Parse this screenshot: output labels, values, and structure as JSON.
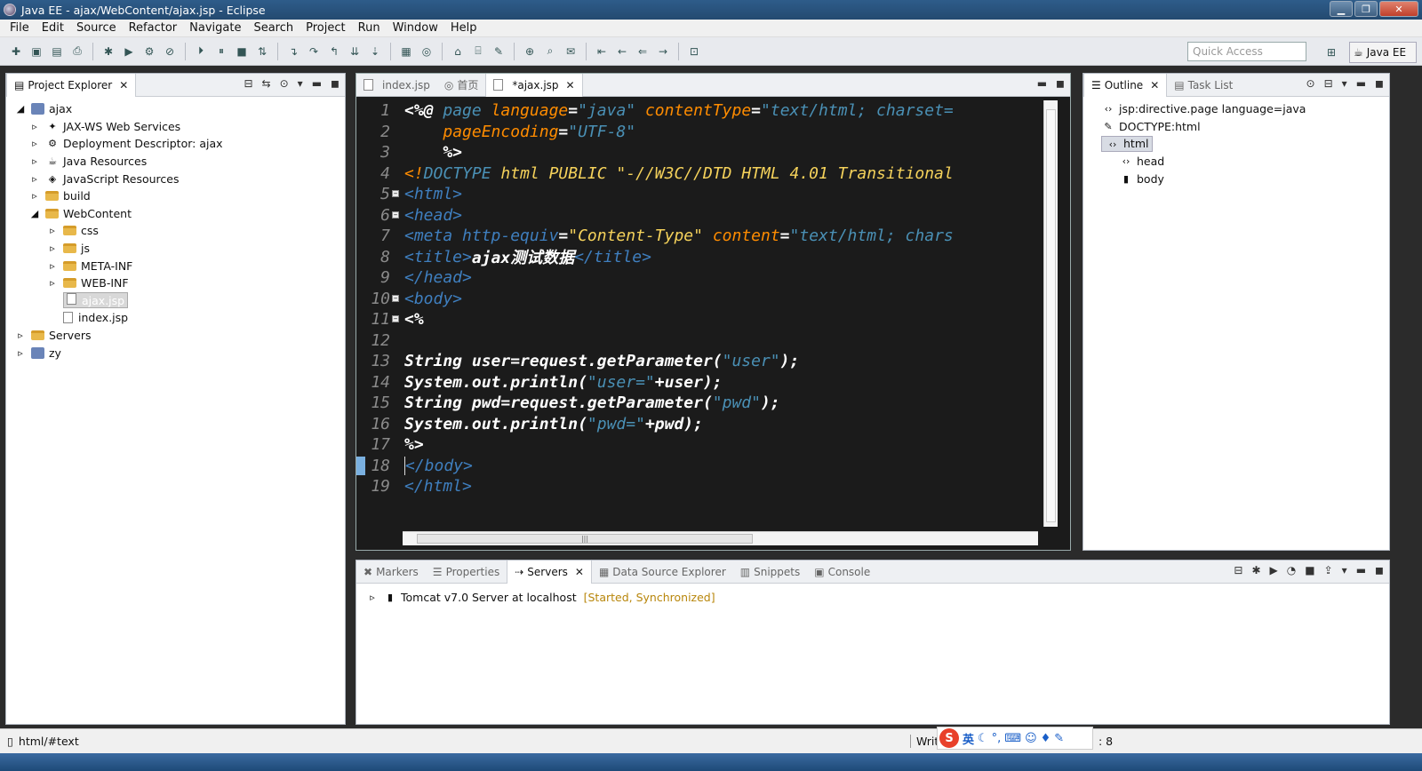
{
  "window": {
    "title": "Java EE - ajax/WebContent/ajax.jsp - Eclipse"
  },
  "menu": [
    "File",
    "Edit",
    "Source",
    "Refactor",
    "Navigate",
    "Search",
    "Project",
    "Run",
    "Window",
    "Help"
  ],
  "toolbar": {
    "quick_access_placeholder": "Quick Access",
    "perspective": "Java EE"
  },
  "project_explorer": {
    "tab_label": "Project Explorer",
    "items": [
      {
        "label": "ajax",
        "level": 0,
        "kind": "project"
      },
      {
        "label": "JAX-WS Web Services",
        "level": 1,
        "kind": "service"
      },
      {
        "label": "Deployment Descriptor: ajax",
        "level": 1,
        "kind": "descriptor"
      },
      {
        "label": "Java Resources",
        "level": 1,
        "kind": "resources"
      },
      {
        "label": "JavaScript Resources",
        "level": 1,
        "kind": "resources"
      },
      {
        "label": "build",
        "level": 1,
        "kind": "folder"
      },
      {
        "label": "WebContent",
        "level": 1,
        "kind": "folder"
      },
      {
        "label": "css",
        "level": 2,
        "kind": "folder"
      },
      {
        "label": "js",
        "level": 2,
        "kind": "folder"
      },
      {
        "label": "META-INF",
        "level": 2,
        "kind": "folder"
      },
      {
        "label": "WEB-INF",
        "level": 2,
        "kind": "folder"
      },
      {
        "label": "ajax.jsp",
        "level": 2,
        "kind": "file",
        "selected": true
      },
      {
        "label": "index.jsp",
        "level": 2,
        "kind": "file"
      },
      {
        "label": "Servers",
        "level": 0,
        "kind": "folder"
      },
      {
        "label": "zy",
        "level": 0,
        "kind": "project"
      }
    ]
  },
  "editor": {
    "tabs": [
      {
        "label": "index.jsp",
        "active": false
      },
      {
        "label": "首页",
        "active": false
      },
      {
        "label": "*ajax.jsp",
        "active": true
      }
    ],
    "line_numbers": [
      "1",
      "2",
      "3",
      "4",
      "5",
      "6",
      "7",
      "8",
      "9",
      "10",
      "11",
      "12",
      "13",
      "14",
      "15",
      "16",
      "17",
      "18",
      "19"
    ],
    "code": {
      "l1a": "<%@ ",
      "l1b": "page ",
      "l1c": "language",
      "l1d": "=",
      "l1e": "\"java\" ",
      "l1f": "contentType",
      "l1g": "=",
      "l1h": "\"text/html; charset=",
      "l2a": "    ",
      "l2b": "pageEncoding",
      "l2c": "=",
      "l2d": "\"UTF-8\"",
      "l3": "    %>",
      "l4a": "<!",
      "l4b": "DOCTYPE ",
      "l4c": "html PUBLIC \"-//W3C//DTD HTML 4.01 Transitional",
      "l5": "<html>",
      "l6": "<head>",
      "l7a": "<meta ",
      "l7b": "http-equiv",
      "l7c": "=",
      "l7d": "\"Content-Type\" ",
      "l7e": "content",
      "l7f": "=",
      "l7g": "\"text/html; chars",
      "l8a": "<title>",
      "l8b": "ajax测试数据",
      "l8c": "</title>",
      "l9": "</head>",
      "l10": "<body>",
      "l11": "<%",
      "l12": "",
      "l13a": "String user=request.getParameter(",
      "l13b": "\"user\"",
      "l13c": ");",
      "l14a": "System.out.println(",
      "l14b": "\"user=\"",
      "l14c": "+user);",
      "l15a": "String pwd=request.getParameter(",
      "l15b": "\"pwd\"",
      "l15c": ");",
      "l16a": "System.out.println(",
      "l16b": "\"pwd=\"",
      "l16c": "+pwd);",
      "l17": "%>",
      "l18": "</body>",
      "l19": "</html>"
    }
  },
  "outline": {
    "tabs": [
      {
        "label": "Outline",
        "active": true
      },
      {
        "label": "Task List",
        "active": false
      }
    ],
    "items": [
      {
        "label": "jsp:directive.page language=java",
        "level": 0
      },
      {
        "label": "DOCTYPE:html",
        "level": 0
      },
      {
        "label": "html",
        "level": 0,
        "selected": true
      },
      {
        "label": "head",
        "level": 1
      },
      {
        "label": "body",
        "level": 1
      }
    ]
  },
  "bottom_panel": {
    "tabs": [
      {
        "label": "Markers",
        "active": false
      },
      {
        "label": "Properties",
        "active": false
      },
      {
        "label": "Servers",
        "active": true
      },
      {
        "label": "Data Source Explorer",
        "active": false
      },
      {
        "label": "Snippets",
        "active": false
      },
      {
        "label": "Console",
        "active": false
      }
    ],
    "server": {
      "name": "Tomcat v7.0 Server at localhost",
      "state": "[Started, Synchronized]"
    }
  },
  "status": {
    "path": "html/#text",
    "mode": "Writa",
    "position": ": 8"
  },
  "ime": {
    "logo": "S",
    "lang": "英"
  },
  "colors": {
    "editor_bg": "#1b1b1b",
    "keyword": "#ff8c00",
    "string": "#4a90b5",
    "tag": "#3f7fbf"
  }
}
